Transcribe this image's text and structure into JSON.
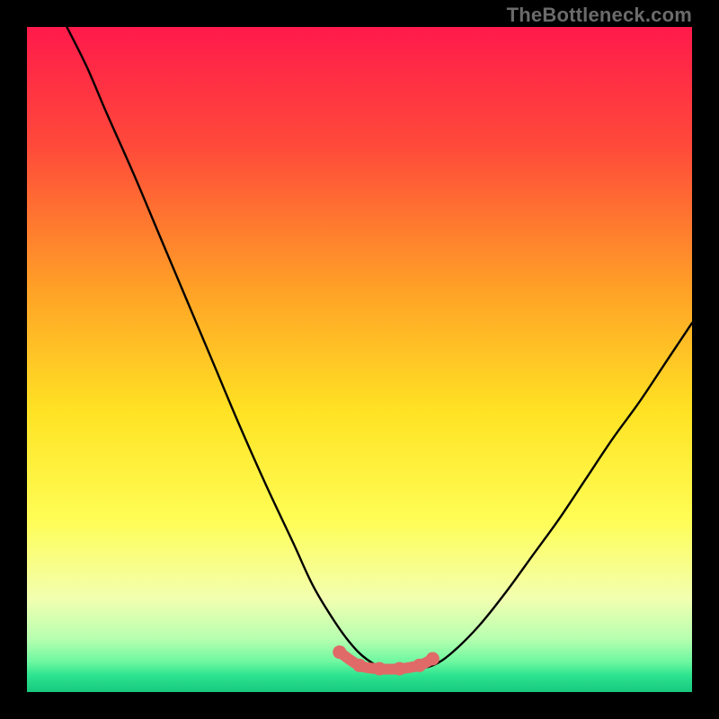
{
  "watermark": "TheBottleneck.com",
  "chart_data": {
    "type": "line",
    "title": "",
    "xlabel": "",
    "ylabel": "",
    "xlim": [
      0,
      1
    ],
    "ylim": [
      0,
      1
    ],
    "grid": false,
    "legend": false,
    "gradient_stops": [
      {
        "offset": 0.0,
        "color": "#ff1a4b"
      },
      {
        "offset": 0.18,
        "color": "#ff4a3a"
      },
      {
        "offset": 0.4,
        "color": "#ffa326"
      },
      {
        "offset": 0.58,
        "color": "#ffe324"
      },
      {
        "offset": 0.74,
        "color": "#fffd55"
      },
      {
        "offset": 0.86,
        "color": "#f2ffb0"
      },
      {
        "offset": 0.92,
        "color": "#b7ffb0"
      },
      {
        "offset": 0.955,
        "color": "#6cf7a0"
      },
      {
        "offset": 0.975,
        "color": "#2de38f"
      },
      {
        "offset": 1.0,
        "color": "#17c97f"
      }
    ],
    "series": [
      {
        "name": "bottleneck-curve",
        "stroke": "#000000",
        "x": [
          0.06,
          0.09,
          0.12,
          0.16,
          0.2,
          0.24,
          0.28,
          0.32,
          0.36,
          0.4,
          0.43,
          0.46,
          0.485,
          0.51,
          0.54,
          0.58,
          0.61,
          0.64,
          0.68,
          0.72,
          0.76,
          0.8,
          0.84,
          0.88,
          0.92,
          0.96,
          1.0
        ],
        "y": [
          1.0,
          0.94,
          0.87,
          0.78,
          0.685,
          0.59,
          0.495,
          0.4,
          0.31,
          0.225,
          0.16,
          0.11,
          0.075,
          0.05,
          0.035,
          0.035,
          0.04,
          0.06,
          0.1,
          0.15,
          0.205,
          0.26,
          0.32,
          0.38,
          0.435,
          0.495,
          0.555
        ]
      }
    ],
    "highlight_segment": {
      "name": "minimum-band",
      "stroke": "#e06a67",
      "x": [
        0.47,
        0.5,
        0.53,
        0.56,
        0.59,
        0.61
      ],
      "y": [
        0.06,
        0.04,
        0.035,
        0.035,
        0.04,
        0.05
      ]
    }
  }
}
